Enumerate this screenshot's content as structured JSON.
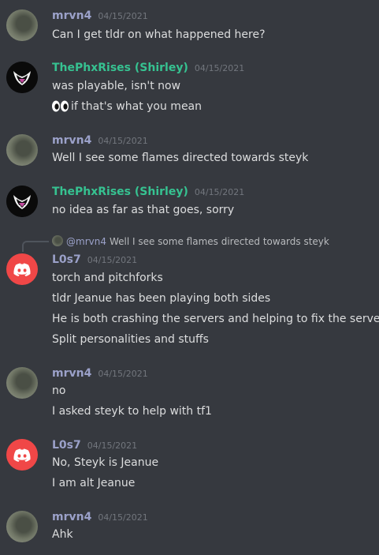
{
  "messages": [
    {
      "author": "mrvn4",
      "time": "04/15/2021",
      "lines": [
        "Can I get tldr on what happened here?"
      ]
    },
    {
      "author": "ThePhxRises (Shirley)",
      "time": "04/15/2021",
      "lines": [
        "was playable, isn't now",
        "if that's what you mean"
      ],
      "emoji": "eyes"
    },
    {
      "author": "mrvn4",
      "time": "04/15/2021",
      "lines": [
        "Well I see some flames directed towards steyk"
      ]
    },
    {
      "author": "ThePhxRises (Shirley)",
      "time": "04/15/2021",
      "lines": [
        "no idea as far as that goes, sorry"
      ]
    },
    {
      "author": "L0s7",
      "time": "04/15/2021",
      "reply": {
        "author": "@mrvn4",
        "text": "Well I see some flames directed towards steyk"
      },
      "lines": [
        "torch and pitchforks",
        "tldr Jeanue has been playing both sides",
        "He is both crashing the servers and helping to fix the servers",
        "Split personalities and stuffs"
      ]
    },
    {
      "author": "mrvn4",
      "time": "04/15/2021",
      "lines": [
        "no",
        "I asked steyk to help with tf1"
      ]
    },
    {
      "author": "L0s7",
      "time": "04/15/2021",
      "lines": [
        "No, Steyk is Jeanue",
        "I am alt Jeanue"
      ]
    },
    {
      "author": "mrvn4",
      "time": "04/15/2021",
      "lines": [
        "Ahk"
      ]
    }
  ],
  "colors": {
    "background": "#36393f",
    "text": "#dcddde",
    "timestamp": "#72767d",
    "mrvn4_name": "#9ba1c9",
    "phx_name": "#36c291",
    "los7_avatar": "#f04747"
  }
}
